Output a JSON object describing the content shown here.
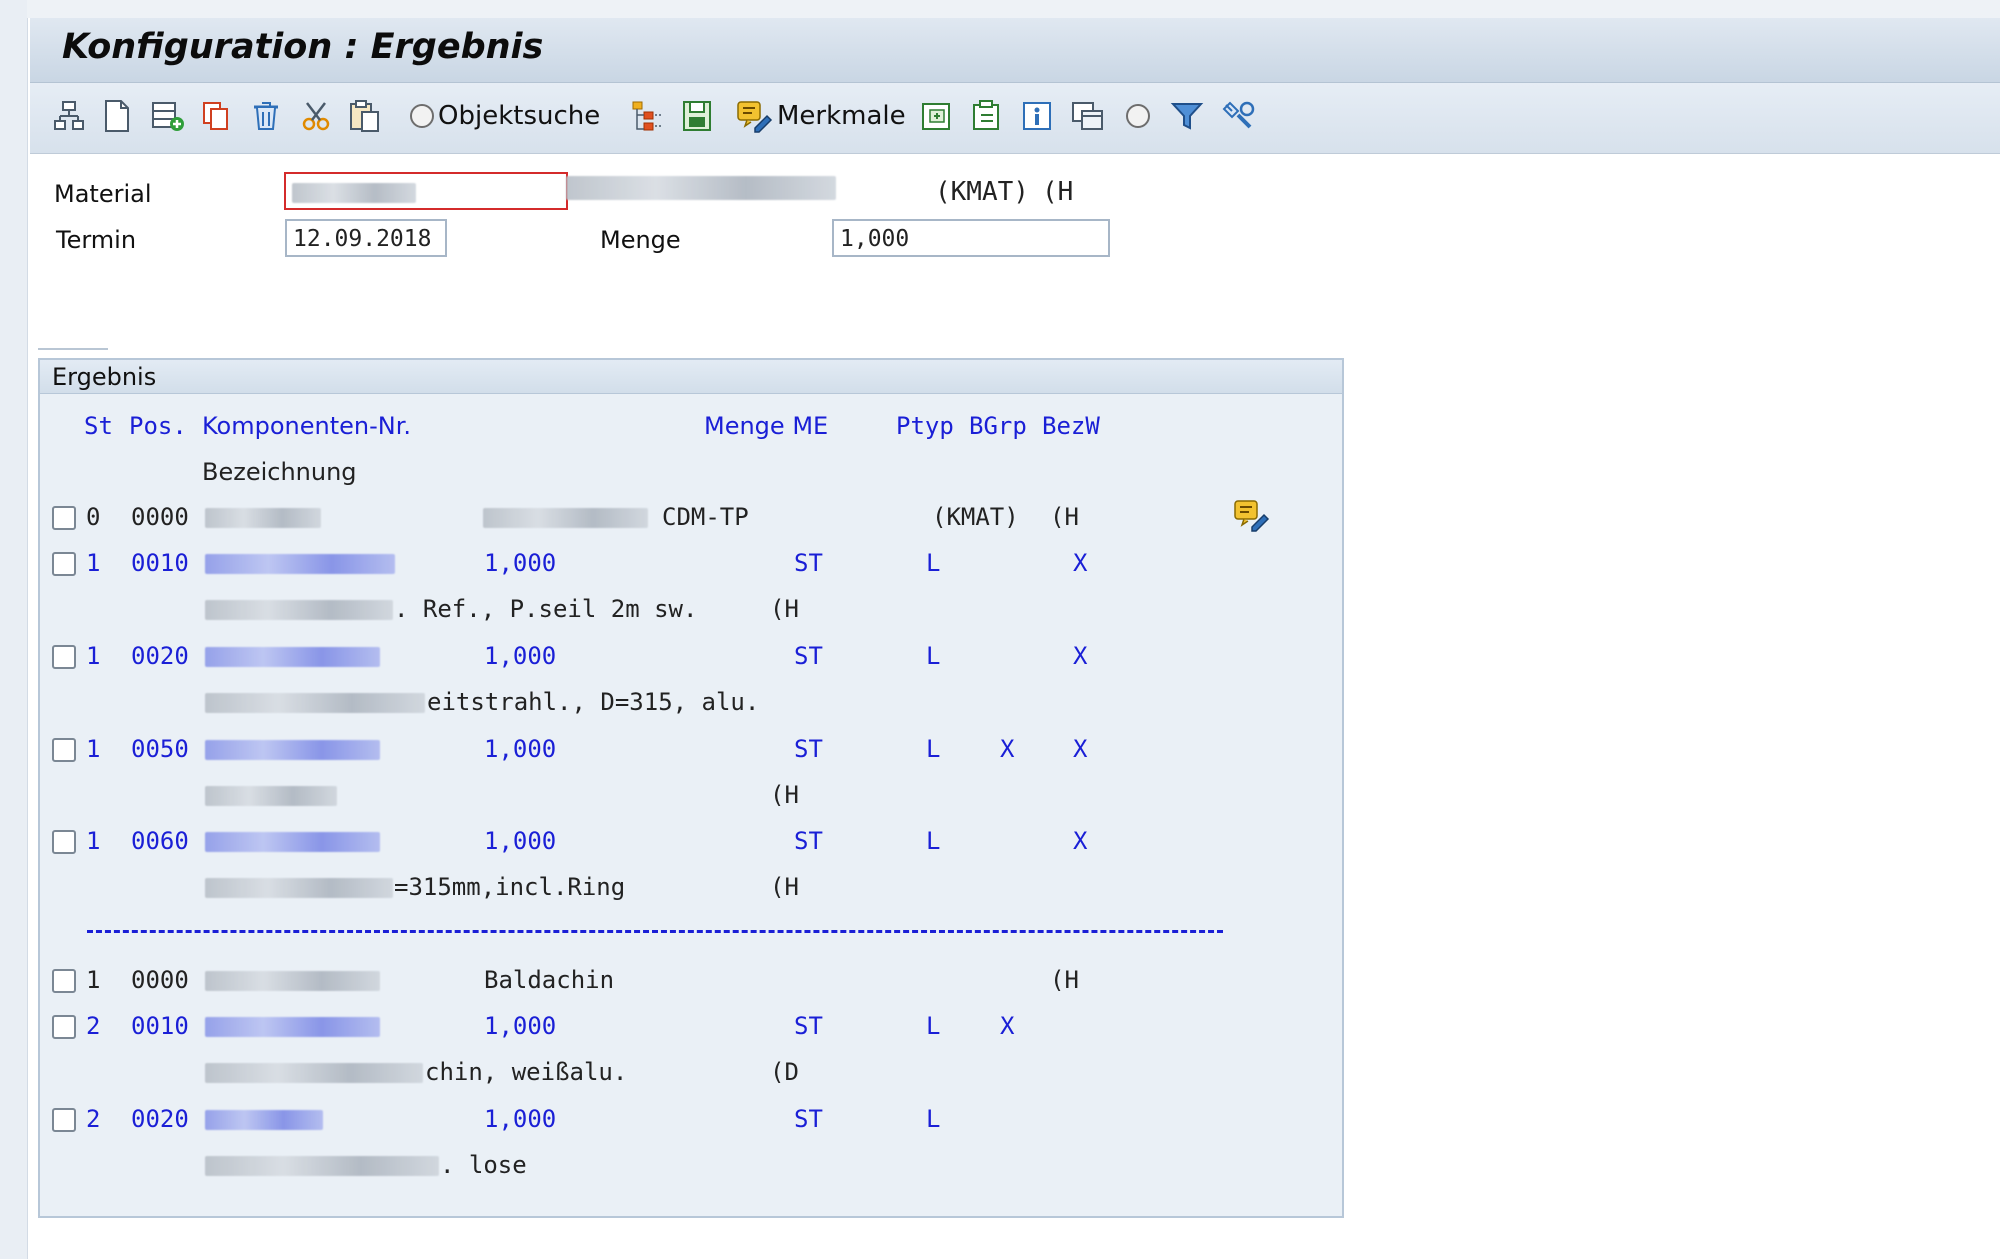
{
  "window": {
    "title": "Konfiguration : Ergebnis"
  },
  "toolbar": {
    "icons": [
      "hierarchy-icon",
      "new-document-icon",
      "add-row-icon",
      "copy-icon",
      "trash-icon",
      "cut-icon",
      "paste-icon"
    ],
    "objektsuche_label": "Objektsuche",
    "merkmale_label": "Merkmale",
    "right_icons": [
      "tree-icon",
      "save-structure-icon",
      "edit-merkmale-icon",
      "import-icon",
      "export-icon",
      "info-icon",
      "copy-window-icon",
      "radio-icon",
      "filter-icon",
      "settings-icon"
    ]
  },
  "header": {
    "material_label": "Material",
    "material_kmat": "(KMAT)",
    "material_flag": "(H",
    "termin_label": "Termin",
    "termin_value": "12.09.2018",
    "menge_label": "Menge",
    "menge_value": "1,000"
  },
  "group": {
    "title": "Ergebnis",
    "columns": {
      "st": "St",
      "pos": "Pos.",
      "komp": "Komponenten-Nr.",
      "menge_me": "Menge ME",
      "ptyp": "Ptyp",
      "bgrp": "BGrp",
      "bezw": "BezW",
      "bezeichnung": "Bezeichnung"
    },
    "rows": [
      {
        "st": "0",
        "pos": "0000",
        "desc_a": "CDM-TP",
        "kmat": "(KMAT)",
        "flag": "(H"
      },
      {
        "st": "1",
        "pos": "0010",
        "menge": "1,000",
        "me": "ST",
        "ptyp": "L",
        "bgrp": "",
        "bezw": "X",
        "desc": ". Ref., P.seil 2m sw.",
        "flag": "(H"
      },
      {
        "st": "1",
        "pos": "0020",
        "menge": "1,000",
        "me": "ST",
        "ptyp": "L",
        "bgrp": "",
        "bezw": "X",
        "desc": "eitstrahl., D=315, alu.",
        "flag": ""
      },
      {
        "st": "1",
        "pos": "0050",
        "menge": "1,000",
        "me": "ST",
        "ptyp": "L",
        "bgrp": "X",
        "bezw": "X",
        "desc": "",
        "flag": "(H"
      },
      {
        "st": "1",
        "pos": "0060",
        "menge": "1,000",
        "me": "ST",
        "ptyp": "L",
        "bgrp": "",
        "bezw": "X",
        "desc": "=315mm,incl.Ring",
        "flag": "(H"
      },
      {
        "st": "1",
        "pos": "0000",
        "desc_a": "Baldachin",
        "flag": "(H"
      },
      {
        "st": "2",
        "pos": "0010",
        "menge": "1,000",
        "me": "ST",
        "ptyp": "L",
        "bgrp": "X",
        "bezw": "",
        "desc": "chin, weißalu.",
        "flag": "(D"
      },
      {
        "st": "2",
        "pos": "0020",
        "menge": "1,000",
        "me": "ST",
        "ptyp": "L",
        "bgrp": "",
        "bezw": "",
        "desc": ". lose",
        "flag": ""
      }
    ]
  },
  "colors": {
    "link_blue": "#1a1fd6",
    "panel_bg": "#eaf0f6",
    "title_bg": "#c9d6e4"
  }
}
